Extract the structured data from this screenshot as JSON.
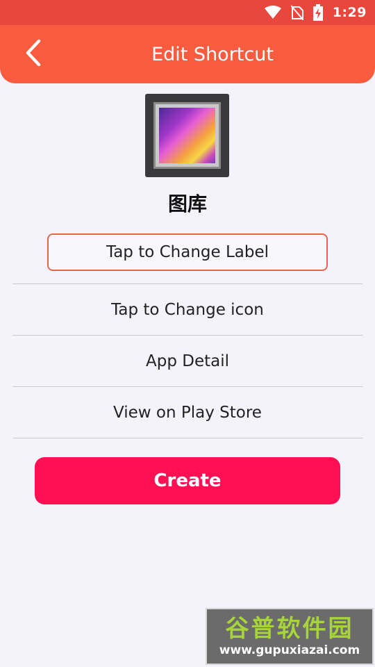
{
  "status_bar": {
    "time": "1:29",
    "icons": [
      "wifi-icon",
      "no-sim-icon",
      "battery-charging-icon"
    ]
  },
  "header": {
    "title": "Edit Shortcut",
    "back_icon": "chevron-left-icon",
    "color": "#f95b3f"
  },
  "shortcut": {
    "app_name": "图库",
    "icon": "gallery-app-icon"
  },
  "actions": {
    "change_label": "Tap to Change Label",
    "change_icon": "Tap to Change icon",
    "app_detail": "App Detail",
    "play_store": "View on Play Store"
  },
  "create_button": {
    "label": "Create",
    "color": "#ff1053"
  },
  "watermark": {
    "title": "谷普软件园",
    "url": "www.gupuxiazai.com"
  }
}
